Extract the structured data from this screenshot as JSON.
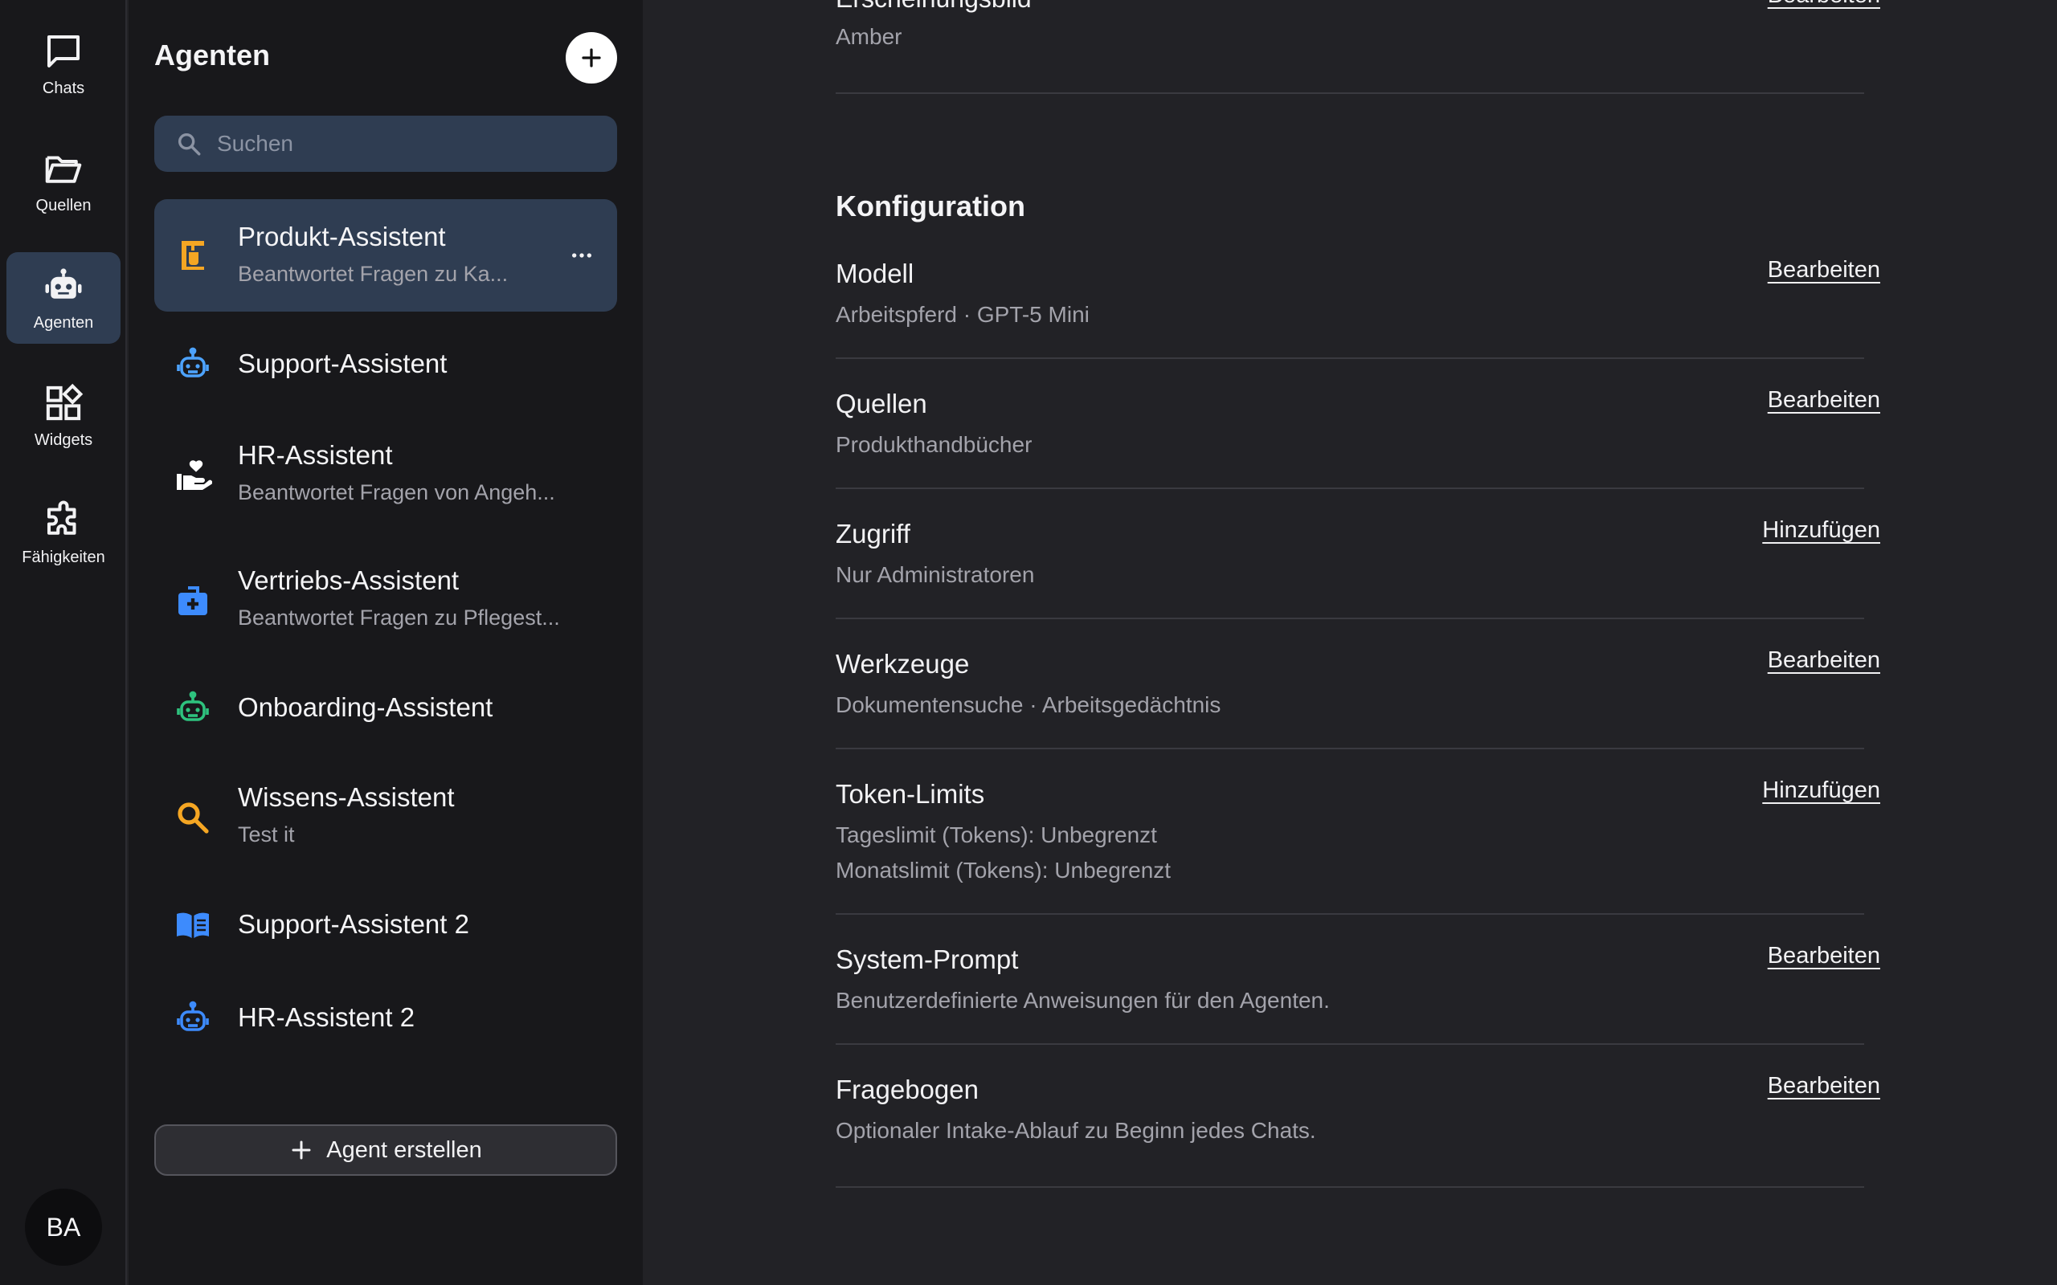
{
  "rail": {
    "items": [
      {
        "label": "Chats",
        "icon": "chat-icon"
      },
      {
        "label": "Quellen",
        "icon": "folder-open-icon"
      },
      {
        "label": "Agenten",
        "icon": "robot-icon",
        "active": true
      },
      {
        "label": "Widgets",
        "icon": "widgets-icon"
      },
      {
        "label": "Fähigkeiten",
        "icon": "puzzle-icon"
      }
    ],
    "avatar": "BA"
  },
  "panel": {
    "title": "Agenten",
    "search_placeholder": "Suchen",
    "agents": [
      {
        "name": "Produkt-Assistent",
        "desc": "Beantwortet Fragen zu Ka...",
        "icon": "coffee-machine-icon",
        "color": "#f5a623",
        "active": true
      },
      {
        "name": "Support-Assistent",
        "desc": "",
        "icon": "robot-icon",
        "color": "#4da3ff"
      },
      {
        "name": "HR-Assistent",
        "desc": "Beantwortet Fragen von Angeh...",
        "icon": "hand-heart-icon",
        "color": "#ffffff"
      },
      {
        "name": "Vertriebs-Assistent",
        "desc": "Beantwortet Fragen zu Pflegest...",
        "icon": "medical-bag-icon",
        "color": "#3d8bfd"
      },
      {
        "name": "Onboarding-Assistent",
        "desc": "",
        "icon": "robot-icon",
        "color": "#2ec27e"
      },
      {
        "name": "Wissens-Assistent",
        "desc": "Test it",
        "icon": "search-icon",
        "color": "#f5a623"
      },
      {
        "name": "Support-Assistent 2",
        "desc": "",
        "icon": "book-icon",
        "color": "#3d8bfd"
      },
      {
        "name": "HR-Assistent 2",
        "desc": "",
        "icon": "robot-icon",
        "color": "#3d8bfd"
      }
    ],
    "create_label": "Agent erstellen"
  },
  "main": {
    "appearance": {
      "title": "Erscheinungsbild",
      "value": "Amber",
      "action": "Bearbeiten"
    },
    "config_heading": "Konfiguration",
    "rows": [
      {
        "title": "Modell",
        "values": [
          "Arbeitspferd · GPT-5 Mini"
        ],
        "action": "Bearbeiten"
      },
      {
        "title": "Quellen",
        "values": [
          "Produkthandbücher"
        ],
        "action": "Bearbeiten"
      },
      {
        "title": "Zugriff",
        "values": [
          "Nur Administratoren"
        ],
        "action": "Hinzufügen"
      },
      {
        "title": "Werkzeuge",
        "values": [
          "Dokumentensuche · Arbeitsgedächtnis"
        ],
        "action": "Bearbeiten"
      },
      {
        "title": "Token-Limits",
        "values": [
          "Tageslimit (Tokens): Unbegrenzt",
          "Monatslimit (Tokens): Unbegrenzt"
        ],
        "action": "Hinzufügen"
      },
      {
        "title": "System-Prompt",
        "values": [
          "Benutzerdefinierte Anweisungen für den Agenten."
        ],
        "action": "Bearbeiten"
      },
      {
        "title": "Fragebogen",
        "values": [
          "Optionaler Intake-Ablauf zu Beginn jedes Chats."
        ],
        "action": "Bearbeiten"
      }
    ]
  }
}
